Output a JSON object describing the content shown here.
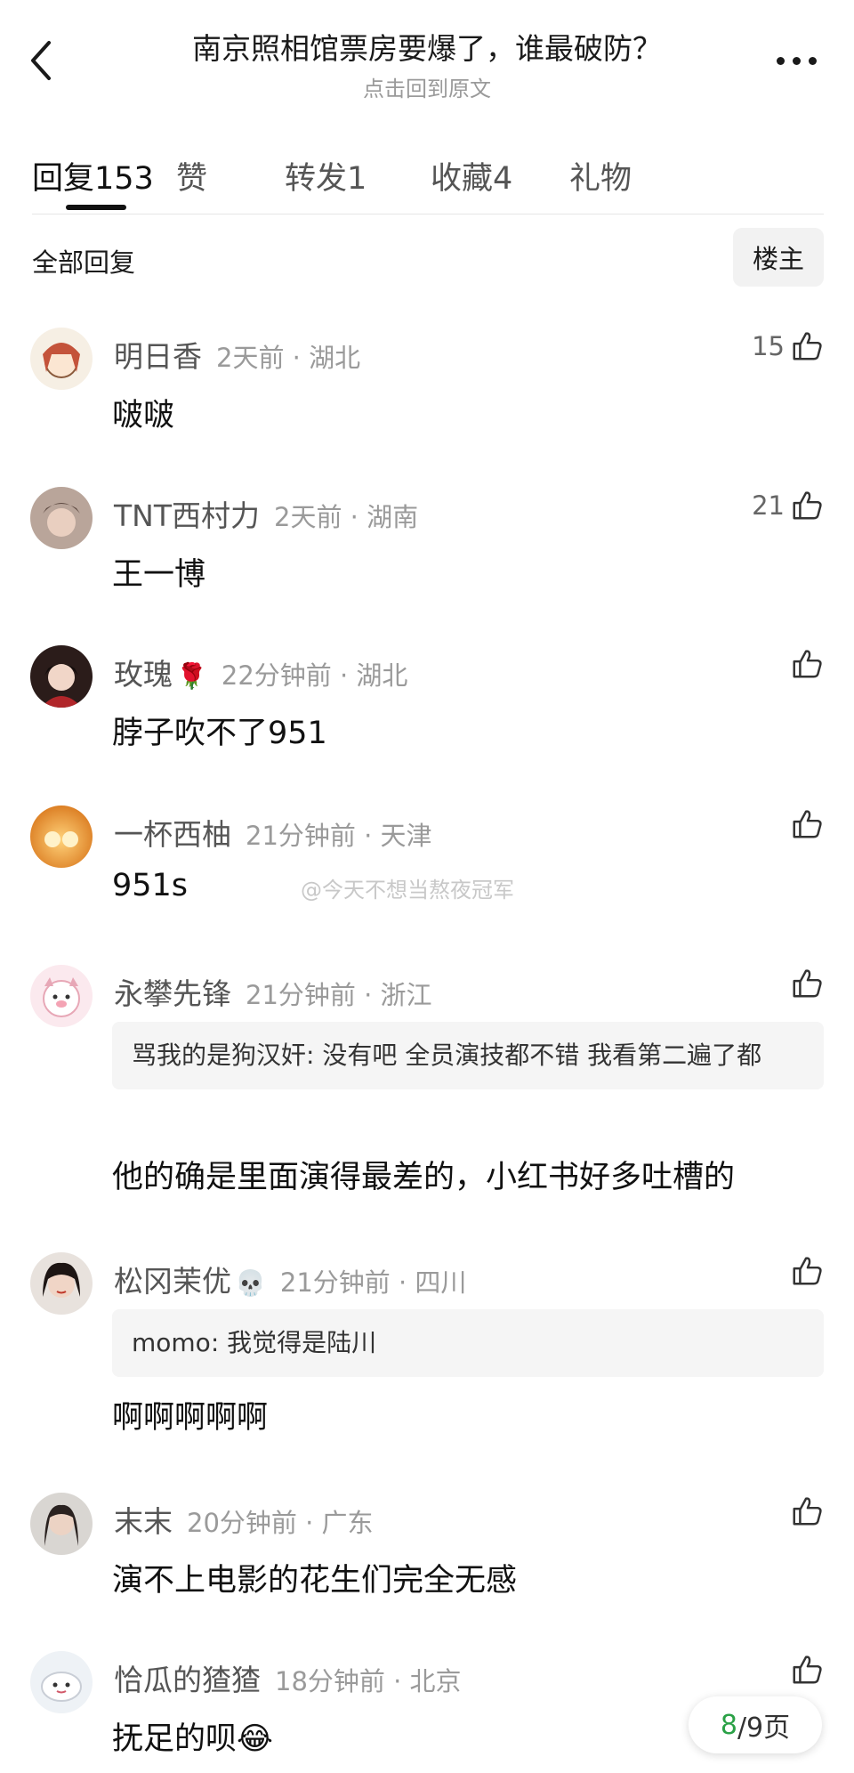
{
  "header": {
    "title": "南京照相馆票房要爆了，谁最破防？",
    "subtitle": "点击回到原文"
  },
  "tabs": [
    {
      "label": "回复",
      "count": "153"
    },
    {
      "label": "赞",
      "count": ""
    },
    {
      "label": "转发",
      "count": "1"
    },
    {
      "label": "收藏",
      "count": "4"
    },
    {
      "label": "礼物",
      "count": ""
    }
  ],
  "filter": {
    "label": "全部回复",
    "owner_button": "楼主"
  },
  "comments": [
    {
      "name": "明日香",
      "emoji": "",
      "time": "2天前 · 湖北",
      "likes": "15",
      "quote": "",
      "text": "啵啵"
    },
    {
      "name": "TNT西村力",
      "emoji": "",
      "time": "2天前 · 湖南",
      "likes": "21",
      "quote": "",
      "text": "王一博"
    },
    {
      "name": "玫瑰",
      "emoji": "🌹",
      "time": "22分钟前 · 湖北",
      "likes": "",
      "quote": "",
      "text": "脖子吹不了951"
    },
    {
      "name": "一杯西柚",
      "emoji": "",
      "time": "21分钟前 · 天津",
      "likes": "",
      "quote": "",
      "text": "951s"
    },
    {
      "name": "永攀先锋",
      "emoji": "",
      "time": "21分钟前 · 浙江",
      "likes": "",
      "quote": "骂我的是狗汉奸: 没有吧 全员演技都不错 我看第二遍了都",
      "text": "他的确是里面演得最差的，小红书好多吐槽的"
    },
    {
      "name": "松冈茉优",
      "emoji": "💀",
      "time": "21分钟前 · 四川",
      "likes": "",
      "quote": "momo: 我觉得是陆川",
      "text": "啊啊啊啊啊"
    },
    {
      "name": "末末",
      "emoji": "",
      "time": "20分钟前 · 广东",
      "likes": "",
      "quote": "",
      "text": "演不上电影的花生们完全无感"
    },
    {
      "name": "恰瓜的猹猹",
      "emoji": "",
      "time": "18分钟前 · 北京",
      "likes": "",
      "quote": "",
      "text": "抚足的呗😂"
    }
  ],
  "watermark": "@今天不想当熬夜冠军",
  "pagination": {
    "current": "8",
    "total_label": "/9页"
  },
  "icons": {
    "back": "chevron-left-icon",
    "more": "more-dots-icon",
    "like": "thumbs-up-icon"
  }
}
